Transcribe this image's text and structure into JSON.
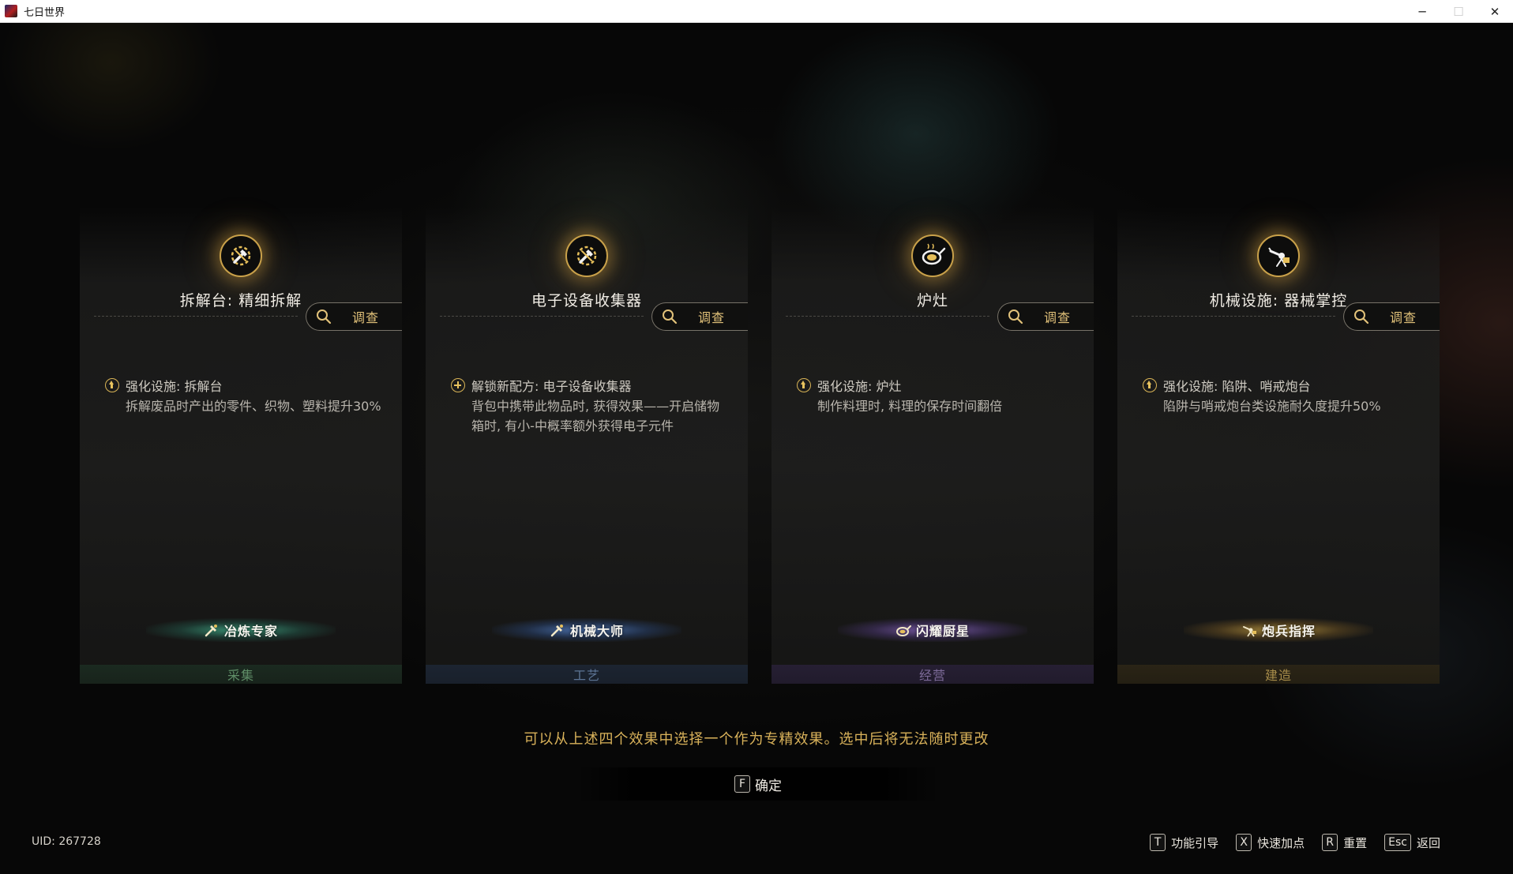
{
  "window": {
    "title": "七日世界",
    "minimize": "─",
    "maximize": "☐",
    "close": "✕"
  },
  "cards": [
    {
      "title": "拆解台: 精细拆解",
      "icon": "wrench-gear-icon",
      "inspect_label": "调查",
      "effect_type": "upgrade",
      "effect_head": "强化设施: 拆解台",
      "effect_body": "拆解废品时产出的零件、织物、塑料提升30%",
      "badge_label": "冶炼专家",
      "badge_icon": "hammer-icon",
      "category": "采集",
      "accent": "#46be96"
    },
    {
      "title": "电子设备收集器",
      "icon": "wrench-gear-icon",
      "inspect_label": "调查",
      "effect_type": "unlock",
      "effect_head": "解锁新配方: 电子设备收集器",
      "effect_body": "背包中携带此物品时, 获得效果——开启储物箱时, 有小-中概率额外获得电子元件",
      "badge_label": "机械大师",
      "badge_icon": "hammer-icon",
      "category": "工艺",
      "accent": "#5a8cdc"
    },
    {
      "title": "炉灶",
      "icon": "frying-pan-icon",
      "inspect_label": "调查",
      "effect_type": "upgrade",
      "effect_head": "强化设施: 炉灶",
      "effect_body": "制作料理时, 料理的保存时间翻倍",
      "badge_label": "闪耀厨星",
      "badge_icon": "frying-pan-icon",
      "category": "经营",
      "accent": "#966ed2"
    },
    {
      "title": "机械设施: 器械掌控",
      "icon": "turret-icon",
      "inspect_label": "调查",
      "effect_type": "upgrade",
      "effect_head": "强化设施: 陷阱、哨戒炮台",
      "effect_body": "陷阱与哨戒炮台类设施耐久度提升50%",
      "badge_label": "炮兵指挥",
      "badge_icon": "turret-icon",
      "category": "建造",
      "accent": "#d2aa46"
    }
  ],
  "hint": "可以从上述四个效果中选择一个作为专精效果。选中后将无法随时更改",
  "confirm": {
    "key": "F",
    "label": "确定"
  },
  "shortcuts": [
    {
      "key": "T",
      "label": "功能引导"
    },
    {
      "key": "X",
      "label": "快速加点"
    },
    {
      "key": "R",
      "label": "重置"
    },
    {
      "key": "Esc",
      "label": "返回"
    }
  ],
  "uid": "UID: 267728"
}
